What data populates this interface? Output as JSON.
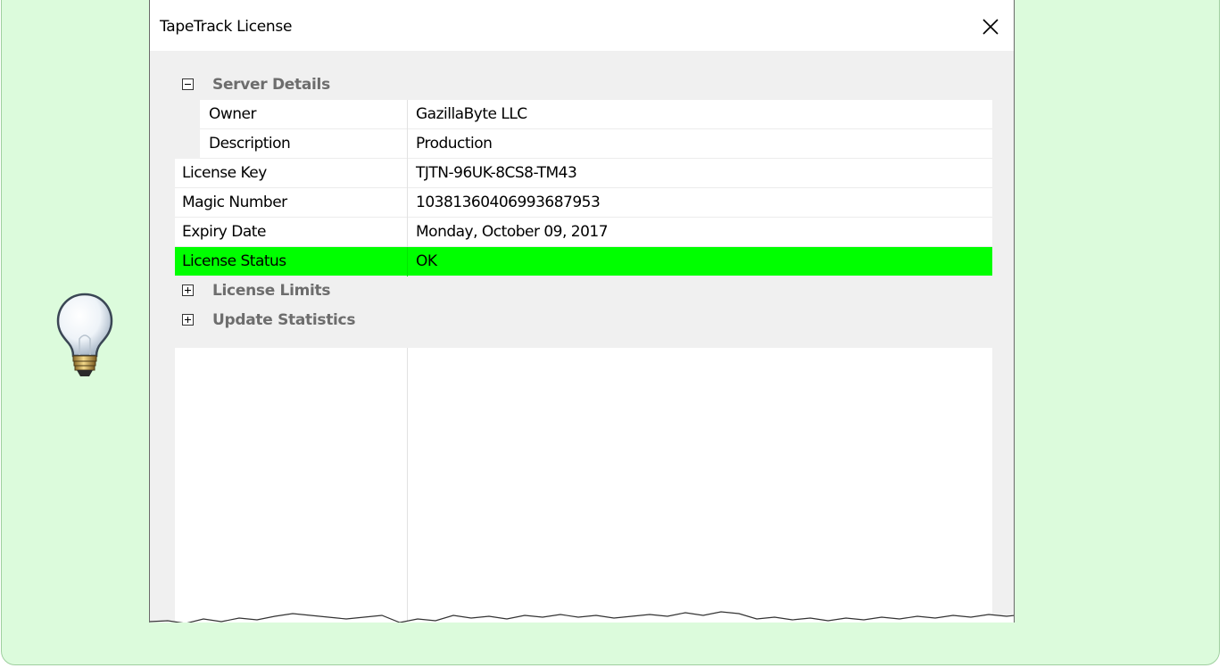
{
  "colors": {
    "callout_bg": "#dcfbdc",
    "status_ok": "#00ff00",
    "category_text": "#6d6d6d"
  },
  "dialog": {
    "title": "TapeTrack License",
    "close_icon": "close-icon"
  },
  "categories": {
    "server_details": {
      "label": "Server Details",
      "expanded": true,
      "icon": "collapse-icon"
    },
    "license_limits": {
      "label": "License Limits",
      "expanded": false,
      "icon": "expand-icon"
    },
    "update_statistics": {
      "label": "Update Statistics",
      "expanded": false,
      "icon": "expand-icon"
    }
  },
  "properties": {
    "owner": {
      "name": "Owner",
      "value": "GazillaByte LLC"
    },
    "description": {
      "name": "Description",
      "value": "Production"
    },
    "license_key": {
      "name": "License Key",
      "value": "TJTN-96UK-8CS8-TM43"
    },
    "magic_number": {
      "name": "Magic Number",
      "value": "10381360406993687953"
    },
    "expiry_date": {
      "name": "Expiry Date",
      "value": "Monday, October 09, 2017"
    },
    "license_status": {
      "name": "License Status",
      "value": "OK"
    }
  },
  "decorations": {
    "tip_icon": "lightbulb-icon"
  }
}
